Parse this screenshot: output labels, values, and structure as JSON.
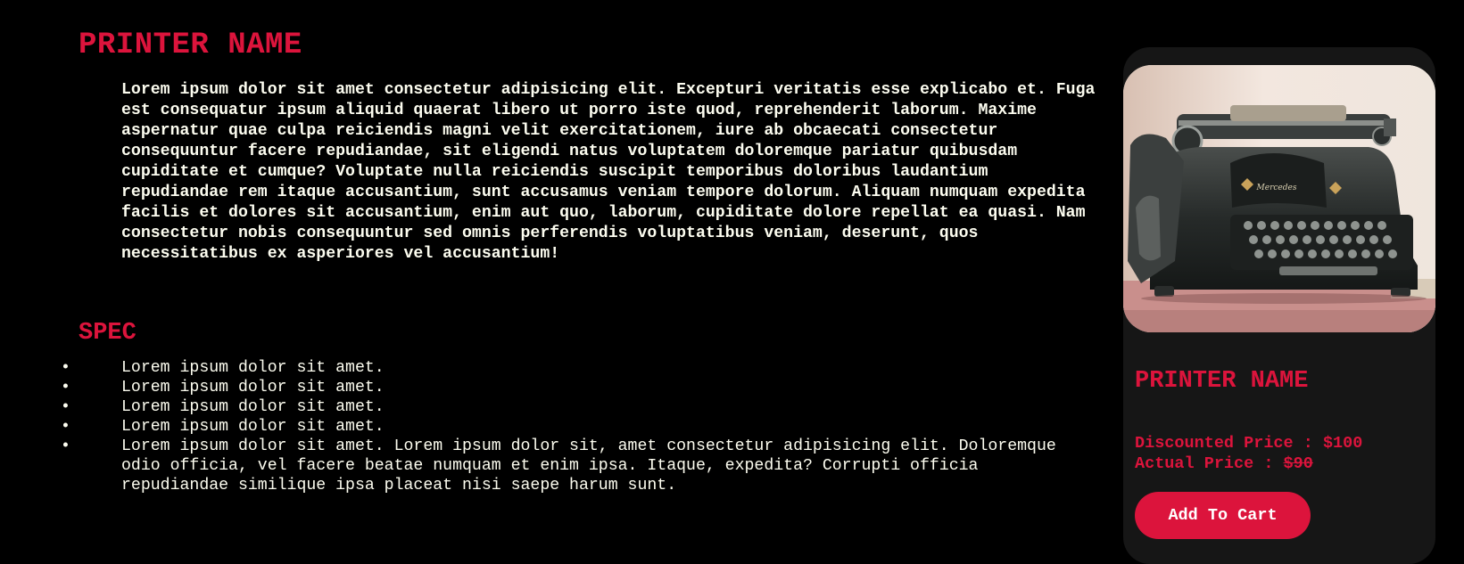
{
  "product": {
    "title": "PRINTER NAME",
    "description": "Lorem ipsum dolor sit amet consectetur adipisicing elit. Excepturi veritatis esse explicabo et. Fuga est consequatur ipsum aliquid quaerat libero ut porro iste quod, reprehenderit laborum. Maxime aspernatur quae culpa reiciendis magni velit exercitationem, iure ab obcaecati consectetur consequuntur facere repudiandae, sit eligendi natus voluptatem doloremque pariatur quibusdam cupiditate et cumque? Voluptate nulla reiciendis suscipit temporibus doloribus laudantium repudiandae rem itaque accusantium, sunt accusamus veniam tempore dolorum. Aliquam numquam expedita facilis et dolores sit accusantium, enim aut quo, laborum, cupiditate dolore repellat ea quasi. Nam consectetur nobis consequuntur sed omnis perferendis voluptatibus veniam, deserunt, quos necessitatibus ex asperiores vel accusantium!"
  },
  "spec": {
    "title": "SPEC",
    "bullet": "•",
    "items": [
      "Lorem ipsum dolor sit amet.",
      "Lorem ipsum dolor sit amet.",
      "Lorem ipsum dolor sit amet.",
      "Lorem ipsum dolor sit amet.",
      "Lorem ipsum dolor sit amet. Lorem ipsum dolor sit, amet consectetur adipisicing elit. Doloremque odio officia, vel facere beatae numquam et enim ipsa. Itaque, expedita? Corrupti officia repudiandae similique ipsa placeat nisi saepe harum sunt."
    ]
  },
  "card": {
    "image_alt": "Vintage Mercedes typewriter",
    "image_brand_text": "Mercedes",
    "title": "PRINTER NAME",
    "discounted_label": "Discounted Price : ",
    "discounted_value": "$100",
    "actual_label": "Actual Price : ",
    "actual_value": "$90",
    "button_label": "Add To Cart"
  },
  "colors": {
    "accent": "#dc143c",
    "background": "#000000",
    "card_background": "#161616",
    "text": "#fdfdf0"
  }
}
